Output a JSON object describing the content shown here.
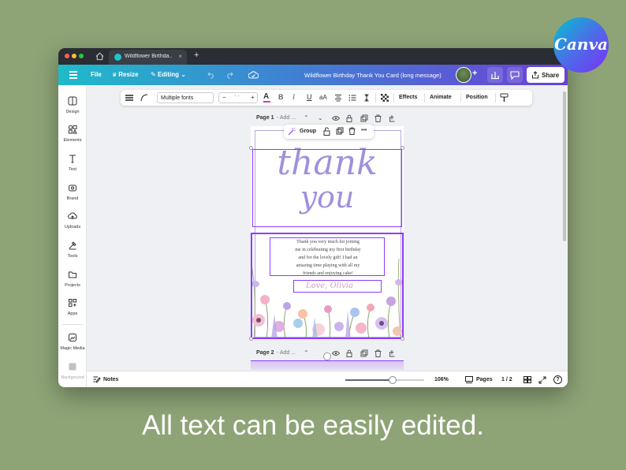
{
  "browser": {
    "tab_title": "Wildflower Birthda...",
    "tab_close": "×",
    "new_tab": "+"
  },
  "header": {
    "file": "File",
    "resize": "Resize",
    "editing": "Editing",
    "doc_title": "Wildflower Birthday Thank You Card (long message)",
    "add": "+",
    "share": "Share"
  },
  "sidebar": {
    "items": [
      {
        "label": "Design",
        "icon": "design-icon"
      },
      {
        "label": "Elements",
        "icon": "elements-icon"
      },
      {
        "label": "Text",
        "icon": "text-icon"
      },
      {
        "label": "Brand",
        "icon": "brand-icon"
      },
      {
        "label": "Uploads",
        "icon": "uploads-icon"
      },
      {
        "label": "Tools",
        "icon": "tools-icon"
      },
      {
        "label": "Projects",
        "icon": "projects-icon"
      },
      {
        "label": "Apps",
        "icon": "apps-icon"
      },
      {
        "label": "Magic Media",
        "icon": "magic-media-icon"
      },
      {
        "label": "Background",
        "icon": "background-icon"
      }
    ]
  },
  "toolbar": {
    "font": "Multiple fonts",
    "size_minus": "−",
    "size_value": "- -",
    "size_plus": "+",
    "text_color": "A",
    "bold": "B",
    "italic": "I",
    "underline": "U",
    "case": "aA",
    "effects": "Effects",
    "animate": "Animate",
    "position": "Position"
  },
  "pages": {
    "page1_label": "Page 1",
    "page1_add": "- Add ...",
    "page2_label": "Page 2",
    "page2_add": "- Add ..."
  },
  "group_tip": {
    "label": "Group",
    "more": "•••"
  },
  "card": {
    "thank": "thank",
    "you": "you",
    "message_lines": [
      "Thank you very much for joining",
      "me in celebrating my first birthday",
      "and for the lovely gift! I had an",
      "amazing time playing with all my",
      "friends and enjoying cake!"
    ],
    "signature": "Love, Olivia",
    "accent_color": "#a190db",
    "selection_color": "#8b3dff"
  },
  "footer": {
    "notes": "Notes",
    "zoom": "106%",
    "zoom_level": 0.6,
    "pages": "Pages",
    "page_count": "1 / 2",
    "help": "?"
  },
  "logo": {
    "text": "Canva"
  },
  "caption": "All text can be easily edited."
}
